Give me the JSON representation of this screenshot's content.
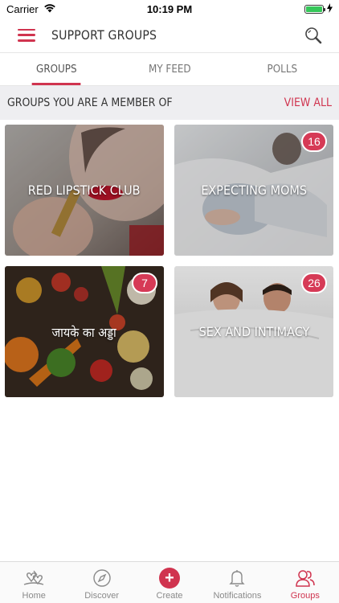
{
  "theme": {
    "accent": "#d0344f",
    "badge": "#d63a56"
  },
  "status_bar": {
    "carrier": "Carrier",
    "time": "10:19 PM",
    "battery_level": 1.0,
    "battery_color": "#35c759"
  },
  "header": {
    "title": "SUPPORT GROUPS",
    "menu_icon": "hamburger-menu-icon",
    "search_icon": "search-icon"
  },
  "tabs": [
    {
      "label": "GROUPS",
      "active": true
    },
    {
      "label": "MY FEED",
      "active": false
    },
    {
      "label": "POLLS",
      "active": false
    }
  ],
  "section": {
    "title": "GROUPS YOU ARE A MEMBER OF",
    "action": "VIEW ALL"
  },
  "groups": [
    {
      "name": "RED LIPSTICK CLUB",
      "badge": ""
    },
    {
      "name": "EXPECTING MOMS",
      "badge": "16"
    },
    {
      "name": "जायके का अड्डा",
      "badge": "7"
    },
    {
      "name": "SEX AND INTIMACY",
      "badge": "26"
    }
  ],
  "bottom_nav": [
    {
      "label": "Home",
      "icon": "home-hearts-icon",
      "active": false
    },
    {
      "label": "Discover",
      "icon": "compass-icon",
      "active": false
    },
    {
      "label": "Create",
      "icon": "plus-circle-icon",
      "active": false
    },
    {
      "label": "Notifications",
      "icon": "bell-icon",
      "active": false
    },
    {
      "label": "Groups",
      "icon": "groups-icon",
      "active": true
    }
  ]
}
